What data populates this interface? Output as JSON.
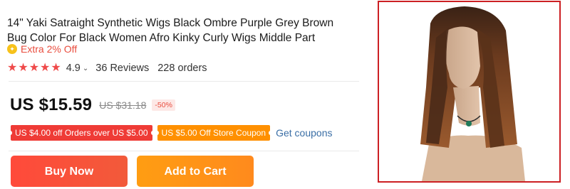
{
  "product": {
    "title": "14\" Yaki Satraight Synthetic Wigs Black Ombre Purple Grey Brown Bug Color For Black Women Afro Kinky Curly Wigs Middle Part",
    "extra_discount": "Extra 2% Off",
    "rating": "4.9",
    "stars": 5,
    "reviews": "36 Reviews",
    "orders": "228 orders"
  },
  "price": {
    "current": "US $15.59",
    "original": "US $31.18",
    "discount": "-50%"
  },
  "coupons": {
    "orders_coupon": "US $4.00 off Orders over US $5.00",
    "store_coupon": "US $5.00 Off Store Coupon",
    "get_coupons": "Get coupons"
  },
  "actions": {
    "buy_now": "Buy Now",
    "add_to_cart": "Add to Cart"
  },
  "colors": {
    "accent_red": "#ef3b36",
    "accent_orange": "#ff9000",
    "star": "#ef4a4a",
    "image_border": "#cc1f23",
    "link": "#3a6ea5"
  },
  "icons": {
    "extra_discount": "coin-icon",
    "rating_dropdown": "chevron-down-icon"
  }
}
